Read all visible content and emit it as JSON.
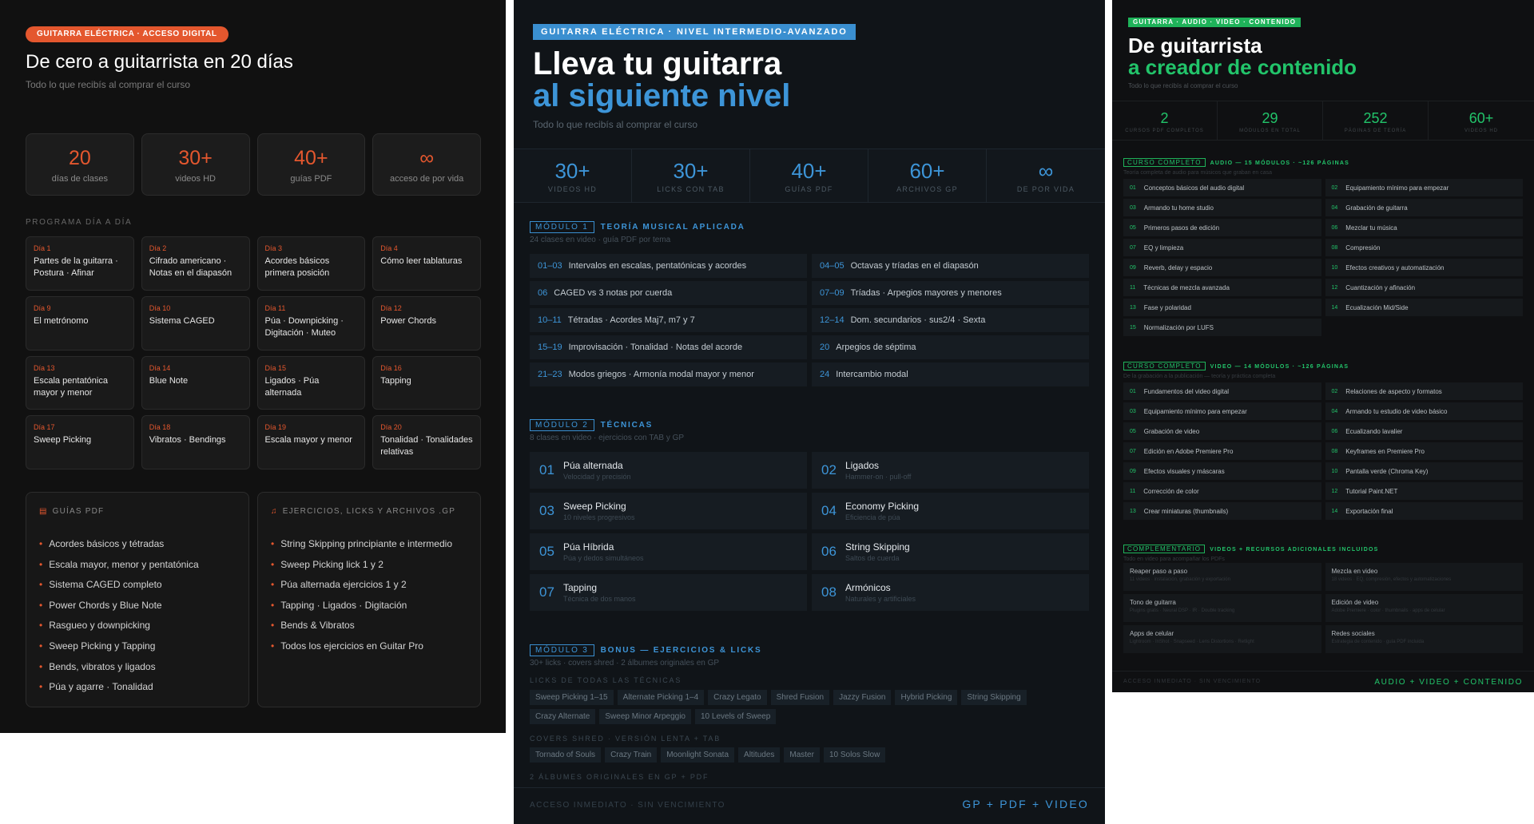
{
  "colors": {
    "orange": "#e4572e",
    "blue": "#3d95d8",
    "green": "#22c46a",
    "dark": "#111111"
  },
  "p1": {
    "badge": "GUITARRA ELÉCTRICA · ACCESO DIGITAL",
    "title": "De cero a guitarrista en 20 días",
    "subtitle": "Todo lo que recibís al comprar el curso",
    "stats": [
      {
        "value": "20",
        "label": "días de clases"
      },
      {
        "value": "30+",
        "label": "videos HD"
      },
      {
        "value": "40+",
        "label": "guías PDF"
      },
      {
        "value": "∞",
        "label": "acceso de por vida"
      }
    ],
    "program_title": "PROGRAMA DÍA A DÍA",
    "days": [
      {
        "day": "Día 1",
        "text": "Partes de la guitarra · Postura · Afinar"
      },
      {
        "day": "Día 2",
        "text": "Cifrado americano · Notas en el diapasón"
      },
      {
        "day": "Día 3",
        "text": "Acordes básicos primera posición"
      },
      {
        "day": "Día 4",
        "text": "Cómo leer tablaturas"
      },
      {
        "day": "Día 9",
        "text": "El metrónomo"
      },
      {
        "day": "Día 10",
        "text": "Sistema CAGED"
      },
      {
        "day": "Día 11",
        "text": "Púa · Downpicking · Digitación · Muteo"
      },
      {
        "day": "Día 12",
        "text": "Power Chords"
      },
      {
        "day": "Día 13",
        "text": "Escala pentatónica mayor y menor"
      },
      {
        "day": "Día 14",
        "text": "Blue Note"
      },
      {
        "day": "Día 15",
        "text": "Ligados · Púa alternada"
      },
      {
        "day": "Día 16",
        "text": "Tapping"
      },
      {
        "day": "Día 17",
        "text": "Sweep Picking"
      },
      {
        "day": "Día 18",
        "text": "Vibratos · Bendings"
      },
      {
        "day": "Día 19",
        "text": "Escala mayor y menor"
      },
      {
        "day": "Día 20",
        "text": "Tonalidad · Tonalidades relativas"
      }
    ],
    "pdf_title": "GUÍAS PDF",
    "pdf_items": [
      "Acordes básicos y tétradas",
      "Escala mayor, menor y pentatónica",
      "Sistema CAGED completo",
      "Power Chords y Blue Note",
      "Rasgueo y downpicking",
      "Sweep Picking y Tapping",
      "Bends, vibratos y ligados",
      "Púa y agarre · Tonalidad"
    ],
    "ex_title": "EJERCICIOS, LICKS Y ARCHIVOS .GP",
    "ex_items": [
      "String Skipping principiante e intermedio",
      "Sweep Picking lick 1 y 2",
      "Púa alternada ejercicios 1 y 2",
      "Tapping · Ligados · Digitación",
      "Bends & Vibratos",
      "Todos los ejercicios en Guitar Pro"
    ]
  },
  "p2": {
    "badge": "GUITARRA ELÉCTRICA · NIVEL INTERMEDIO-AVANZADO",
    "title_1": "Lleva tu guitarra",
    "title_2": "al siguiente nivel",
    "subtitle": "Todo lo que recibís al comprar el curso",
    "stats": [
      {
        "value": "30+",
        "label": "VIDEOS HD"
      },
      {
        "value": "30+",
        "label": "LICKS CON TAB"
      },
      {
        "value": "40+",
        "label": "GUÍAS PDF"
      },
      {
        "value": "60+",
        "label": "ARCHIVOS GP"
      },
      {
        "value": "∞",
        "label": "DE POR VIDA"
      }
    ],
    "m1": {
      "tag": "MÓDULO 1",
      "name": "TEORÍA MUSICAL APLICADA",
      "meta": "24 clases en video · guía PDF por tema",
      "items": [
        {
          "n": "01–03",
          "t": "Intervalos en escalas, pentatónicas y acordes"
        },
        {
          "n": "04–05",
          "t": "Octavas y tríadas en el diapasón"
        },
        {
          "n": "06",
          "t": "CAGED vs 3 notas por cuerda"
        },
        {
          "n": "07–09",
          "t": "Tríadas · Arpegios mayores y menores"
        },
        {
          "n": "10–11",
          "t": "Tétradas · Acordes Maj7, m7 y 7"
        },
        {
          "n": "12–14",
          "t": "Dom. secundarios · sus2/4 · Sexta"
        },
        {
          "n": "15–19",
          "t": "Improvisación · Tonalidad · Notas del acorde"
        },
        {
          "n": "20",
          "t": "Arpegios de séptima"
        },
        {
          "n": "21–23",
          "t": "Modos griegos · Armonía modal mayor y menor"
        },
        {
          "n": "24",
          "t": "Intercambio modal"
        }
      ]
    },
    "m2": {
      "tag": "MÓDULO 2",
      "name": "TÉCNICAS",
      "meta": "8 clases en video · ejercicios con TAB y GP",
      "items": [
        {
          "n": "01",
          "t": "Púa alternada",
          "s": "Velocidad y precisión"
        },
        {
          "n": "02",
          "t": "Ligados",
          "s": "Hammer-on · pull-off"
        },
        {
          "n": "03",
          "t": "Sweep Picking",
          "s": "10 niveles progresivos"
        },
        {
          "n": "04",
          "t": "Economy Picking",
          "s": "Eficiencia de púa"
        },
        {
          "n": "05",
          "t": "Púa Híbrida",
          "s": "Púa y dedos simultáneos"
        },
        {
          "n": "06",
          "t": "String Skipping",
          "s": "Saltos de cuerda"
        },
        {
          "n": "07",
          "t": "Tapping",
          "s": "Técnica de dos manos"
        },
        {
          "n": "08",
          "t": "Armónicos",
          "s": "Naturales y artificiales"
        }
      ]
    },
    "m3": {
      "tag": "MÓDULO 3",
      "name": "BONUS — EJERCICIOS & LICKS",
      "meta": "30+ licks · covers shred · 2 álbumes originales en GP",
      "licks_title": "LICKS DE TODAS LAS TÉCNICAS",
      "licks": [
        "Sweep Picking 1–15",
        "Alternate Picking 1–4",
        "Crazy Legato",
        "Shred Fusion",
        "Jazzy Fusion",
        "Hybrid Picking",
        "String Skipping",
        "Crazy Alternate",
        "Sweep Minor Arpeggio",
        "10 Levels of Sweep"
      ],
      "covers_title": "COVERS SHRED · VERSIÓN LENTA + TAB",
      "covers": [
        "Tornado of Souls",
        "Crazy Train",
        "Moonlight Sonata",
        "Altitudes",
        "Master",
        "10 Solos Slow"
      ],
      "albums_title": "2 ÁLBUMES ORIGINALES EN GP + PDF"
    },
    "footer_left": "ACCESO INMEDIATO · SIN VENCIMIENTO",
    "footer_right": "GP + PDF + VIDEO"
  },
  "p3": {
    "badge": "GUITARRA · AUDIO · VIDEO · CONTENIDO",
    "title_1": "De guitarrista",
    "title_2": "a creador de contenido",
    "subtitle": "Todo lo que recibís al comprar el curso",
    "stats": [
      {
        "value": "2",
        "label": "CURSOS PDF COMPLETOS"
      },
      {
        "value": "29",
        "label": "MÓDULOS EN TOTAL"
      },
      {
        "value": "252",
        "label": "PÁGINAS DE TEORÍA"
      },
      {
        "value": "60+",
        "label": "VIDEOS HD"
      }
    ],
    "audio": {
      "tag": "CURSO COMPLETO",
      "name": "AUDIO — 15 MÓDULOS · ~126 PÁGINAS",
      "meta": "Teoría completa de audio para músicos que graban en casa",
      "items": [
        {
          "n": "01",
          "t": "Conceptos básicos del audio digital"
        },
        {
          "n": "02",
          "t": "Equipamiento mínimo para empezar"
        },
        {
          "n": "03",
          "t": "Armando tu home studio"
        },
        {
          "n": "04",
          "t": "Grabación de guitarra"
        },
        {
          "n": "05",
          "t": "Primeros pasos de edición"
        },
        {
          "n": "06",
          "t": "Mezclar tu música"
        },
        {
          "n": "07",
          "t": "EQ y limpieza"
        },
        {
          "n": "08",
          "t": "Compresión"
        },
        {
          "n": "09",
          "t": "Reverb, delay y espacio"
        },
        {
          "n": "10",
          "t": "Efectos creativos y automatización"
        },
        {
          "n": "11",
          "t": "Técnicas de mezcla avanzada"
        },
        {
          "n": "12",
          "t": "Cuantización y afinación"
        },
        {
          "n": "13",
          "t": "Fase y polaridad"
        },
        {
          "n": "14",
          "t": "Ecualización Mid/Side"
        },
        {
          "n": "15",
          "t": "Normalización por LUFS"
        }
      ]
    },
    "video": {
      "tag": "CURSO COMPLETO",
      "name": "VIDEO — 14 MÓDULOS · ~126 PÁGINAS",
      "meta": "De la grabación a la publicación — teoría y práctica completa",
      "items": [
        {
          "n": "01",
          "t": "Fundamentos del video digital"
        },
        {
          "n": "02",
          "t": "Relaciones de aspecto y formatos"
        },
        {
          "n": "03",
          "t": "Equipamiento mínimo para empezar"
        },
        {
          "n": "04",
          "t": "Armando tu estudio de video básico"
        },
        {
          "n": "05",
          "t": "Grabación de video"
        },
        {
          "n": "06",
          "t": "Ecualizando lavalier"
        },
        {
          "n": "07",
          "t": "Edición en Adobe Premiere Pro"
        },
        {
          "n": "08",
          "t": "Keyframes en Premiere Pro"
        },
        {
          "n": "09",
          "t": "Efectos visuales y máscaras"
        },
        {
          "n": "10",
          "t": "Pantalla verde (Chroma Key)"
        },
        {
          "n": "11",
          "t": "Corrección de color"
        },
        {
          "n": "12",
          "t": "Tutorial Paint.NET"
        },
        {
          "n": "13",
          "t": "Crear miniaturas (thumbnails)"
        },
        {
          "n": "14",
          "t": "Exportación final"
        }
      ]
    },
    "comp": {
      "tag": "COMPLEMENTARIO",
      "name": "VIDEOS + RECURSOS ADICIONALES INCLUIDOS",
      "meta": "Todo en video para acompañar los PDFs",
      "items": [
        {
          "t": "Reaper paso a paso",
          "s": "11 videos · instalación, grabación y exportación"
        },
        {
          "t": "Mezcla en video",
          "s": "18 videos · EQ, compresión, efectos y automatizaciones"
        },
        {
          "t": "Tono de guitarra",
          "s": "Plugins gratis · Neural DSP · IR · Double tracking"
        },
        {
          "t": "Edición de video",
          "s": "Adobe Premiere · color · thumbnails · apps de celular"
        },
        {
          "t": "Apps de celular",
          "s": "Lightroom · InShot · Snapseed · Lens Distortions · Retlight"
        },
        {
          "t": "Redes sociales",
          "s": "Estrategia de contenido · guía PDF incluida"
        }
      ]
    },
    "footer_left": "ACCESO INMEDIATO · SIN VENCIMIENTO",
    "footer_right": "AUDIO + VIDEO + CONTENIDO"
  }
}
